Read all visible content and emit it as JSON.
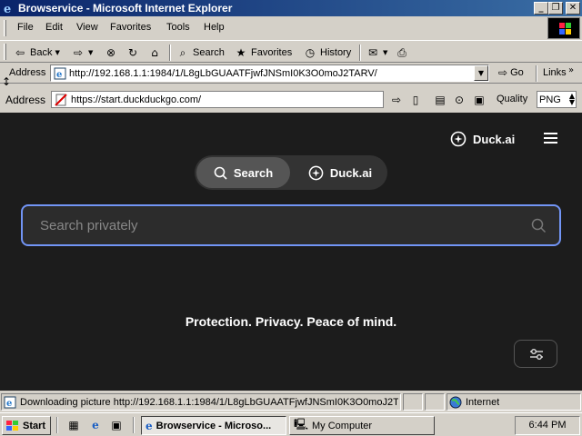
{
  "window": {
    "title": "Browservice - Microsoft Internet Explorer",
    "minimize_glyph": "_",
    "maximize_glyph": "❐",
    "close_glyph": "✕"
  },
  "menu": {
    "items": [
      "File",
      "Edit",
      "View",
      "Favorites",
      "Tools",
      "Help"
    ]
  },
  "toolbar": {
    "back_label": "Back",
    "search_label": "Search",
    "favorites_label": "Favorites",
    "history_label": "History"
  },
  "address_bar": {
    "label": "Address",
    "url": "http://192.168.1.1:1984/1/L8gLbGUAATFjwfJNSmI0K3O0moJ2TARV/",
    "go_label": "Go",
    "links_label": "Links"
  },
  "inner_bar": {
    "label": "Address",
    "url": "https://start.duckduckgo.com/",
    "quality_label": "Quality",
    "quality_value": "PNG"
  },
  "page": {
    "duck_ai_link": "Duck.ai",
    "tabs": [
      {
        "label": "Search",
        "active": true
      },
      {
        "label": "Duck.ai",
        "active": false
      }
    ],
    "search_placeholder": "Search privately",
    "tagline": "Protection. Privacy. Peace of mind.",
    "accent_color": "#7295f6"
  },
  "status_bar": {
    "message": "Downloading picture http://192.168.1.1:1984/1/L8gLbGUAATFjwfJNSmI0K3O0moJ2TA",
    "zone": "Internet"
  },
  "taskbar": {
    "start_label": "Start",
    "tasks": [
      {
        "label": "Browservice - Microso...",
        "active": true
      },
      {
        "label": "My Computer",
        "active": false
      }
    ],
    "clock": "6:44 PM"
  }
}
